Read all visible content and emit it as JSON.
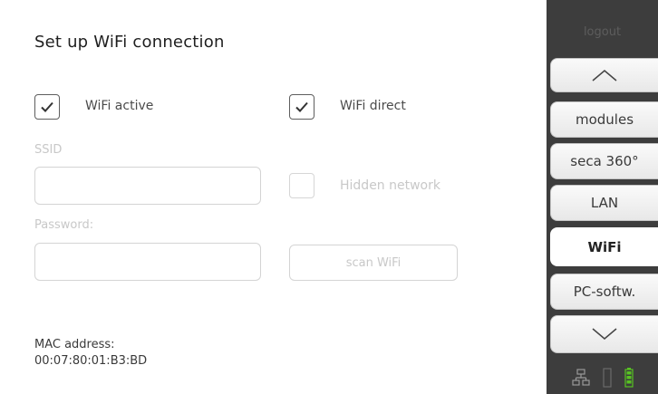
{
  "main": {
    "title": "Set up WiFi connection",
    "wifi_active_label": "WiFi active",
    "wifi_direct_label": "WiFi direct",
    "ssid_label": "SSID",
    "ssid_value": "",
    "hidden_network_label": "Hidden network",
    "password_label": "Password:",
    "password_value": "",
    "scan_wifi_label": "scan WiFi",
    "mac_label": "MAC address:",
    "mac_value": "00:07:80:01:B3:BD",
    "wifi_active_checked": true,
    "wifi_direct_checked": true,
    "hidden_network_checked": false
  },
  "sidebar": {
    "logout_label": "logout",
    "items": [
      {
        "label": "modules"
      },
      {
        "label": "seca 360°"
      },
      {
        "label": "LAN"
      },
      {
        "label": "WiFi",
        "active": true
      },
      {
        "label": "PC-softw."
      }
    ],
    "status_icons": [
      "network-icon",
      "wireless-signal-icon",
      "battery-icon"
    ]
  },
  "colors": {
    "sidebar_bg": "#3d3d3d",
    "battery_green": "#58c322"
  }
}
